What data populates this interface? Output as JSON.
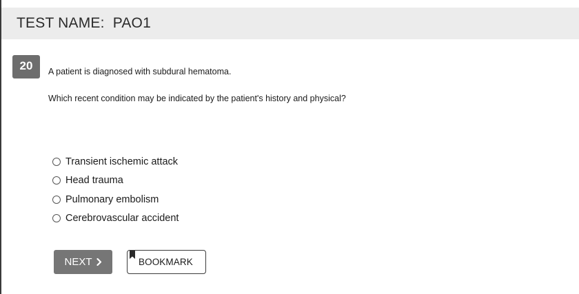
{
  "header": {
    "title": "TEST NAME:  PAO1"
  },
  "question": {
    "number": "20",
    "stem": "A patient is diagnosed with subdural hematoma.",
    "prompt": "Which recent condition may be indicated by the patient's history and physical?",
    "options": [
      {
        "label": "Transient ischemic attack",
        "selected": false
      },
      {
        "label": "Head trauma",
        "selected": false
      },
      {
        "label": "Pulmonary embolism",
        "selected": false
      },
      {
        "label": "Cerebrovascular accident",
        "selected": false
      }
    ]
  },
  "actions": {
    "next_label": "NEXT",
    "next_icon": "chevron-right-icon",
    "bookmark_label": "BOOKMARK",
    "bookmark_icon": "bookmark-icon"
  },
  "colors": {
    "header_bg": "#ececec",
    "badge_bg": "#6d6d6d",
    "next_bg": "#767676"
  }
}
